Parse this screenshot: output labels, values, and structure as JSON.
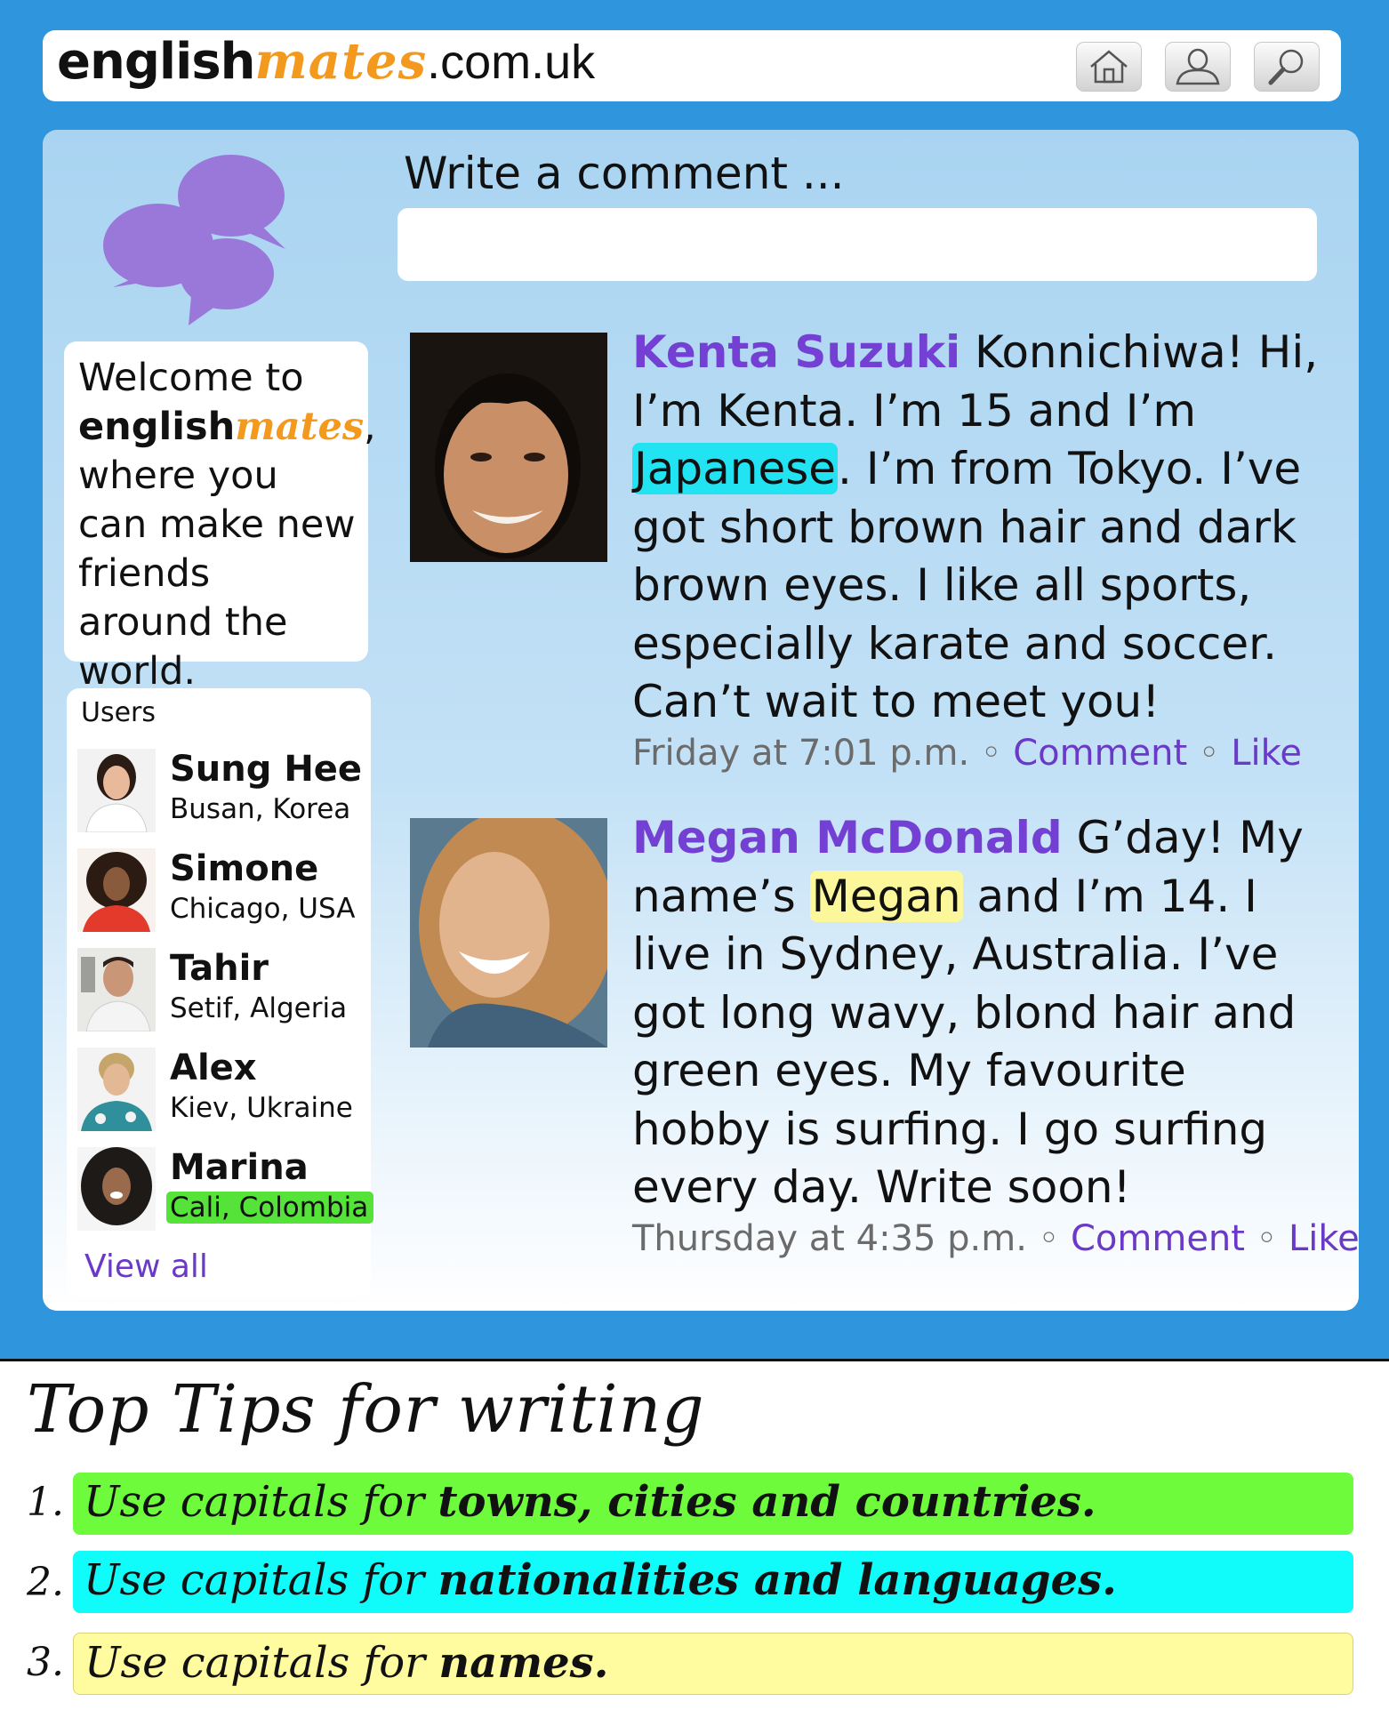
{
  "header": {
    "site_part1": "english",
    "site_part2": "mates",
    "site_part3": ".com.uk",
    "nav_icons": [
      "home-icon",
      "user-icon",
      "search-icon"
    ]
  },
  "sidebar": {
    "welcome": {
      "line1": "Welcome to",
      "brand1": "english",
      "brand2": "mates",
      "after_brand": ",",
      "rest": "where you can make new friends around the world."
    },
    "users_title": "Users",
    "users": [
      {
        "name": "Sung Hee",
        "location": "Busan, Korea"
      },
      {
        "name": "Simone",
        "location": "Chicago, USA"
      },
      {
        "name": "Tahir",
        "location": "Setif, Algeria"
      },
      {
        "name": "Alex",
        "location": "Kiev, Ukraine"
      },
      {
        "name": "Marina",
        "location": "Cali, Colombia"
      }
    ],
    "view_all": "View all"
  },
  "composer": {
    "label": "Write a comment ...",
    "value": ""
  },
  "posts": [
    {
      "author": "Kenta Suzuki",
      "text_a": " Konnichiwa! Hi, I’m Kenta. I’m 15 and I’m ",
      "highlight": "Japanese",
      "text_b": ". I’m from Tokyo. I’ve got short brown hair and dark brown eyes. I like all sports, especially karate and soccer. Can’t wait to meet you!",
      "time": "Friday at 7:01 p.m.",
      "sep": " ◦ ",
      "comment": "Comment",
      "like": "Like"
    },
    {
      "author": "Megan McDonald",
      "text_a": " G’day! My name’s ",
      "highlight": "Megan",
      "text_b": " and I’m 14. I live in Sydney, Australia. I’ve got long wavy, blond hair and green eyes. My favourite hobby is surfing. I go surfing every day. Write soon!",
      "time": "Thursday at 4:35 p.m.",
      "sep": " ◦ ",
      "comment": "Comment",
      "like": "Like"
    }
  ],
  "tips": {
    "title": "Top Tips for writing",
    "items": [
      {
        "num": "1.",
        "prefix": "Use capitals for ",
        "emphasis": "towns, cities and countries.",
        "color": "#6dfb3c"
      },
      {
        "num": "2.",
        "prefix": "Use capitals for ",
        "emphasis": "nationalities and languages.",
        "color": "#0ffcfb"
      },
      {
        "num": "3.",
        "prefix": "Use capitals for ",
        "emphasis": "names.",
        "color": "#fffb9f"
      }
    ]
  },
  "colors": {
    "band": "#2f95dc",
    "brand_orange": "#f39a1e",
    "author_purple": "#7440d4",
    "link_purple": "#6a39c8",
    "bubble_purple": "#9a78da"
  }
}
